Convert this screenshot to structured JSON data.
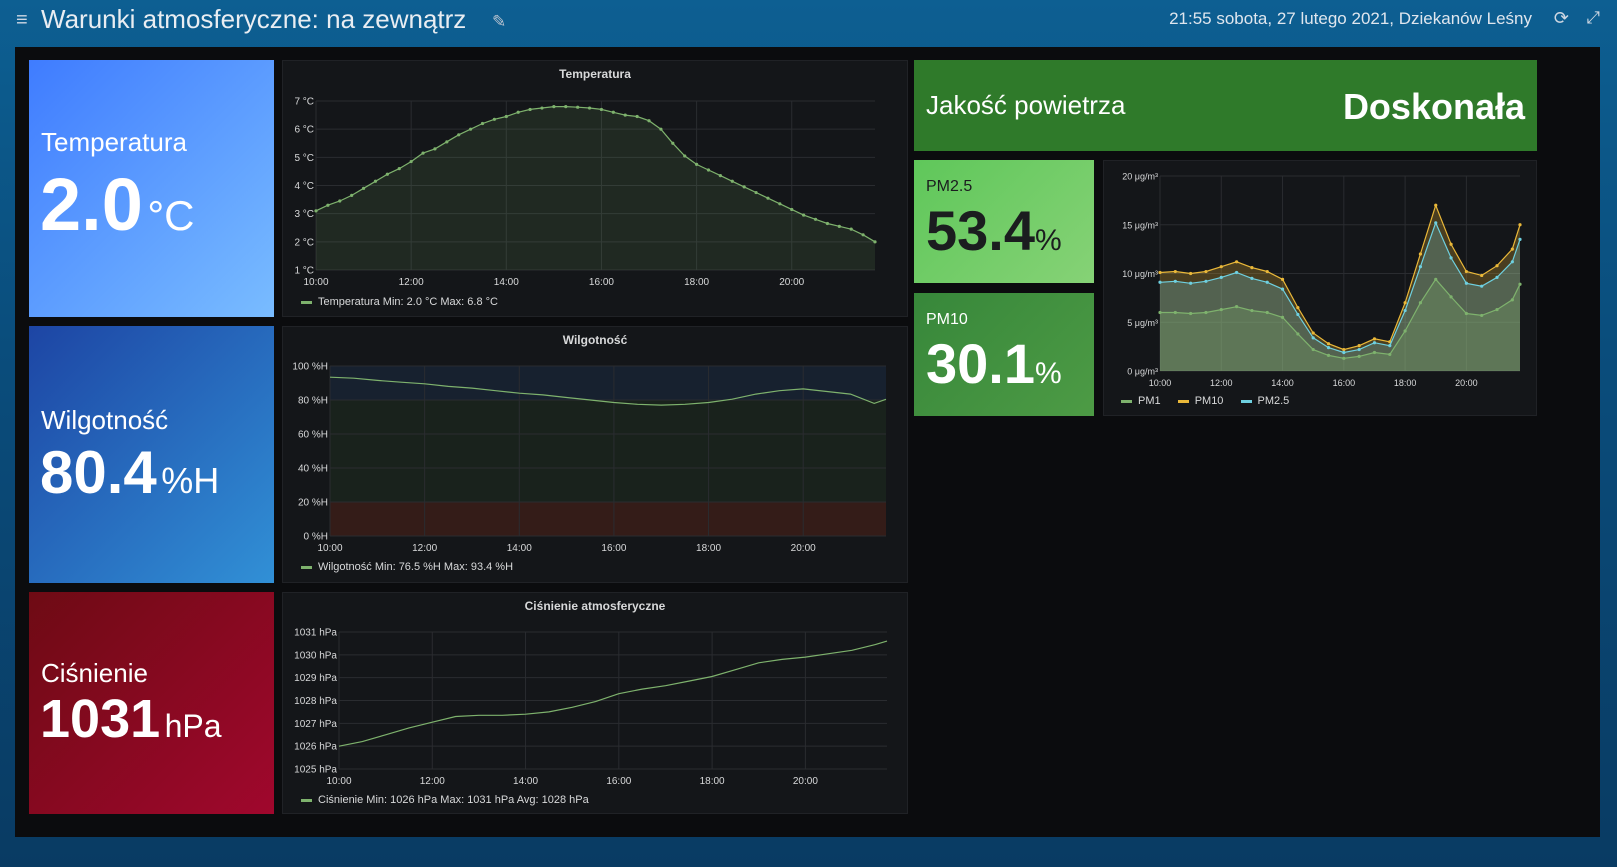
{
  "header": {
    "title": "Warunki atmosferyczne: na zewnątrz",
    "datetime": "21:55 sobota, 27 lutego 2021, Dziekanów Leśny",
    "icons": {
      "menu": "≡",
      "edit": "✎",
      "refresh": "⟳",
      "expand": "⤢"
    }
  },
  "colors": {
    "temp_gradient": [
      "#3f7cff",
      "#79bcff"
    ],
    "hum_gradient": [
      "#1d45a4",
      "#3190d6"
    ],
    "press_gradient": [
      "#6e0b14",
      "#a0072d"
    ],
    "air_quality": "#2f7a2a",
    "pm25_gradient": [
      "#5fc75a",
      "#86d276"
    ],
    "pm10_gradient": [
      "#37873a",
      "#4d9b45"
    ],
    "series_green": "#7eb26d",
    "series_yellow": "#eab839",
    "series_blue": "#6ed0e0"
  },
  "stats": {
    "temperature": {
      "label": "Temperatura",
      "value": "2.0",
      "unit": "°C"
    },
    "humidity": {
      "label": "Wilgotność",
      "value": "80.4",
      "unit": "%H"
    },
    "pressure": {
      "label": "Ciśnienie",
      "value": "1031",
      "unit": "hPa"
    }
  },
  "air_quality": {
    "label": "Jakość powietrza",
    "value": "Doskonała"
  },
  "pm25": {
    "label": "PM2.5",
    "value": "53.4",
    "unit": "%"
  },
  "pm10": {
    "label": "PM10",
    "value": "30.1",
    "unit": "%"
  },
  "chart_data": [
    {
      "id": "temperature",
      "type": "line",
      "title": "Temperatura",
      "x_ticks": [
        "10:00",
        "12:00",
        "14:00",
        "16:00",
        "18:00",
        "20:00"
      ],
      "x_range": [
        10,
        21.75
      ],
      "y_ticks": [
        "1 °C",
        "2 °C",
        "3 °C",
        "4 °C",
        "5 °C",
        "6 °C",
        "7 °C"
      ],
      "ylim": [
        1,
        7
      ],
      "points": true,
      "series": [
        {
          "name": "Temperatura",
          "legend": "Temperatura  Min: 2.0 °C  Max: 6.8 °C",
          "color": "#7eb26d",
          "x": [
            10,
            10.25,
            10.5,
            10.75,
            11,
            11.25,
            11.5,
            11.75,
            12,
            12.25,
            12.5,
            12.75,
            13,
            13.25,
            13.5,
            13.75,
            14,
            14.25,
            14.5,
            14.75,
            15,
            15.25,
            15.5,
            15.75,
            16,
            16.25,
            16.5,
            16.75,
            17,
            17.25,
            17.5,
            17.75,
            18,
            18.25,
            18.5,
            18.75,
            19,
            19.25,
            19.5,
            19.75,
            20,
            20.25,
            20.5,
            20.75,
            21,
            21.25,
            21.5,
            21.75
          ],
          "y": [
            3.1,
            3.3,
            3.45,
            3.65,
            3.9,
            4.15,
            4.4,
            4.6,
            4.85,
            5.15,
            5.3,
            5.55,
            5.8,
            6.0,
            6.2,
            6.35,
            6.45,
            6.6,
            6.7,
            6.75,
            6.8,
            6.8,
            6.78,
            6.75,
            6.7,
            6.6,
            6.5,
            6.45,
            6.3,
            6.0,
            5.5,
            5.05,
            4.75,
            4.55,
            4.35,
            4.15,
            3.95,
            3.75,
            3.55,
            3.35,
            3.15,
            2.95,
            2.8,
            2.65,
            2.55,
            2.45,
            2.25,
            2.0
          ]
        }
      ]
    },
    {
      "id": "humidity",
      "type": "line",
      "title": "Wilgotność",
      "x_ticks": [
        "10:00",
        "12:00",
        "14:00",
        "16:00",
        "18:00",
        "20:00"
      ],
      "x_range": [
        10,
        21.75
      ],
      "y_ticks": [
        "0 %H",
        "20 %H",
        "40 %H",
        "60 %H",
        "80 %H",
        "100 %H"
      ],
      "ylim": [
        0,
        100
      ],
      "threshold_bands": [
        {
          "from": 0,
          "to": 20,
          "color": "rgba(120,45,25,0.32)"
        },
        {
          "from": 20,
          "to": 80,
          "color": "rgba(40,70,35,0.28)"
        },
        {
          "from": 80,
          "to": 100,
          "color": "rgba(30,55,90,0.35)"
        }
      ],
      "series": [
        {
          "name": "Wilgotność",
          "legend": "Wilgotność  Min: 76.5 %H  Max: 93.4 %H",
          "color": "#7eb26d",
          "x": [
            10,
            10.5,
            11,
            11.5,
            12,
            12.5,
            13,
            13.5,
            14,
            14.5,
            15,
            15.5,
            16,
            16.5,
            17,
            17.5,
            18,
            18.5,
            19,
            19.5,
            20,
            20.5,
            21,
            21.5,
            21.75
          ],
          "y": [
            93.4,
            92.8,
            91.5,
            90.5,
            89.5,
            88.0,
            87.0,
            85.5,
            84.0,
            83.0,
            81.5,
            80.0,
            78.5,
            77.5,
            77.0,
            77.5,
            78.5,
            80.5,
            83.5,
            85.5,
            86.5,
            85.0,
            83.5,
            78.0,
            80.4
          ]
        }
      ]
    },
    {
      "id": "pressure",
      "type": "line",
      "title": "Ciśnienie atmosferyczne",
      "x_ticks": [
        "10:00",
        "12:00",
        "14:00",
        "16:00",
        "18:00",
        "20:00"
      ],
      "x_range": [
        10,
        21.75
      ],
      "y_ticks": [
        "1025 hPa",
        "1026 hPa",
        "1027 hPa",
        "1028 hPa",
        "1029 hPa",
        "1030 hPa",
        "1031 hPa"
      ],
      "ylim": [
        1025,
        1031
      ],
      "series": [
        {
          "name": "Ciśnienie",
          "legend": "Ciśnienie  Min: 1026 hPa  Max: 1031 hPa  Avg: 1028 hPa",
          "color": "#7eb26d",
          "x": [
            10,
            10.5,
            11,
            11.5,
            12,
            12.5,
            13,
            13.5,
            14,
            14.5,
            15,
            15.5,
            16,
            16.5,
            17,
            17.5,
            18,
            18.5,
            19,
            19.5,
            20,
            20.5,
            21,
            21.5,
            21.75
          ],
          "y": [
            1026.0,
            1026.2,
            1026.5,
            1026.8,
            1027.05,
            1027.3,
            1027.35,
            1027.35,
            1027.4,
            1027.5,
            1027.7,
            1027.95,
            1028.3,
            1028.5,
            1028.65,
            1028.85,
            1029.05,
            1029.35,
            1029.65,
            1029.8,
            1029.9,
            1030.05,
            1030.2,
            1030.45,
            1030.6
          ]
        }
      ]
    },
    {
      "id": "pm",
      "type": "area",
      "title": "",
      "x_ticks": [
        "10:00",
        "12:00",
        "14:00",
        "16:00",
        "18:00",
        "20:00"
      ],
      "x_range": [
        10,
        21.75
      ],
      "y_ticks": [
        "0 μg/m³",
        "5 μg/m³",
        "10 μg/m³",
        "15 μg/m³",
        "20 μg/m³"
      ],
      "ylim": [
        0,
        20
      ],
      "points": true,
      "series": [
        {
          "name": "PM10",
          "color": "#eab839",
          "x": [
            10,
            10.5,
            11,
            11.5,
            12,
            12.5,
            13,
            13.5,
            14,
            14.5,
            15,
            15.5,
            16,
            16.5,
            17,
            17.5,
            18,
            18.5,
            19,
            19.5,
            20,
            20.5,
            21,
            21.5,
            21.75
          ],
          "y": [
            10.1,
            10.2,
            10.0,
            10.2,
            10.7,
            11.2,
            10.6,
            10.2,
            9.4,
            6.5,
            3.9,
            2.8,
            2.2,
            2.6,
            3.3,
            3.0,
            7.0,
            12.0,
            17.0,
            13.0,
            10.2,
            9.8,
            10.8,
            12.5,
            15.0
          ]
        },
        {
          "name": "PM2.5",
          "color": "#6ed0e0",
          "x": [
            10,
            10.5,
            11,
            11.5,
            12,
            12.5,
            13,
            13.5,
            14,
            14.5,
            15,
            15.5,
            16,
            16.5,
            17,
            17.5,
            18,
            18.5,
            19,
            19.5,
            20,
            20.5,
            21,
            21.5,
            21.75
          ],
          "y": [
            9.1,
            9.2,
            9.0,
            9.2,
            9.6,
            10.1,
            9.5,
            9.1,
            8.4,
            5.8,
            3.4,
            2.4,
            1.9,
            2.2,
            2.9,
            2.6,
            6.2,
            10.7,
            15.2,
            11.6,
            9.0,
            8.7,
            9.6,
            11.2,
            13.5
          ]
        },
        {
          "name": "PM1",
          "color": "#7eb26d",
          "x": [
            10,
            10.5,
            11,
            11.5,
            12,
            12.5,
            13,
            13.5,
            14,
            14.5,
            15,
            15.5,
            16,
            16.5,
            17,
            17.5,
            18,
            18.5,
            19,
            19.5,
            20,
            20.5,
            21,
            21.5,
            21.75
          ],
          "y": [
            6.0,
            6.0,
            5.9,
            6.0,
            6.3,
            6.6,
            6.2,
            6.0,
            5.5,
            3.8,
            2.2,
            1.6,
            1.3,
            1.5,
            1.9,
            1.7,
            4.1,
            7.0,
            9.4,
            7.6,
            5.9,
            5.7,
            6.3,
            7.3,
            8.9
          ]
        }
      ],
      "legend_order": [
        "PM1",
        "PM10",
        "PM2.5"
      ]
    }
  ]
}
